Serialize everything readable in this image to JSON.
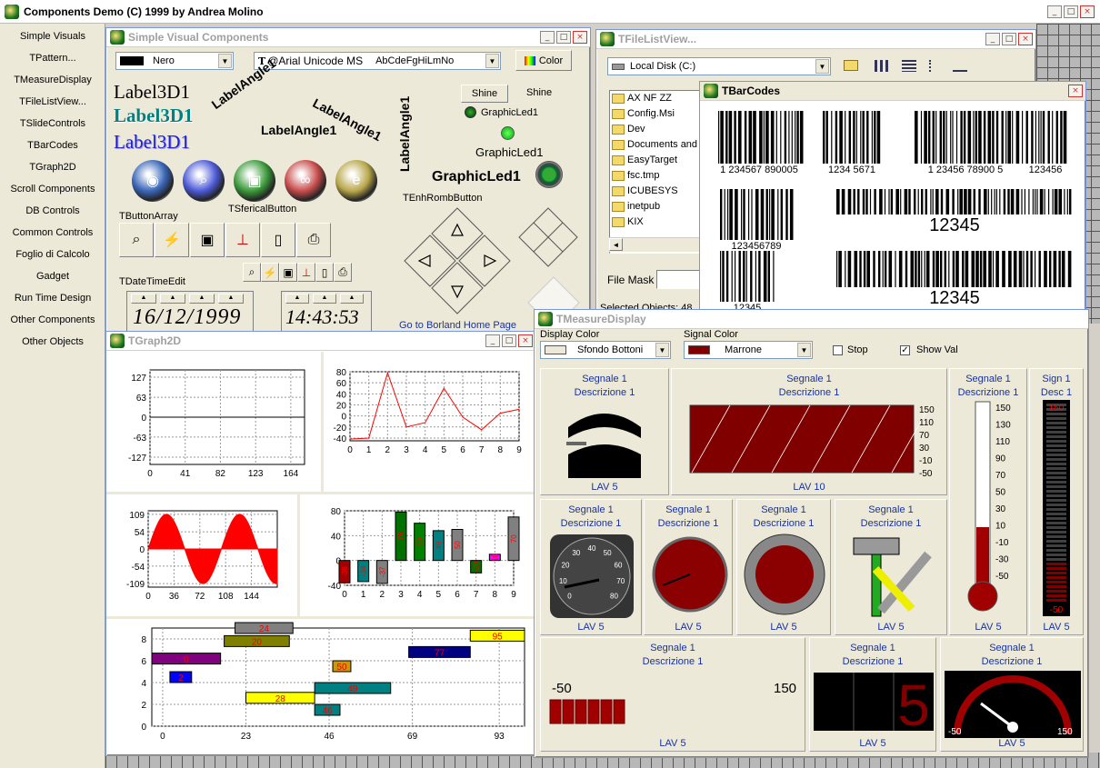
{
  "app": {
    "title": "Components Demo (C) 1999 by Andrea Molino"
  },
  "sidebar": {
    "items": [
      {
        "label": "Simple Visuals"
      },
      {
        "label": "TPattern..."
      },
      {
        "label": "TMeasureDisplay"
      },
      {
        "label": "TFileListView..."
      },
      {
        "label": "TSlideControls"
      },
      {
        "label": "TBarCodes"
      },
      {
        "label": "TGraph2D"
      },
      {
        "label": "Scroll Components"
      },
      {
        "label": "DB Controls"
      },
      {
        "label": "Common Controls"
      },
      {
        "label": "Foglio di Calcolo"
      },
      {
        "label": "Gadget"
      },
      {
        "label": "Run Time Design"
      },
      {
        "label": "Other Components"
      },
      {
        "label": "Other Objects"
      }
    ]
  },
  "simple": {
    "title": "Simple Visual Components",
    "color_combo": "Nero",
    "font_combo": "@Arial Unicode MS",
    "font_sample": "AbCdeFgHiLmNo",
    "color_btn": "Color",
    "label3d": "Label3D1",
    "label_angle": "LabelAngle1",
    "shine_btn": "Shine",
    "shine_lbl": "Shine",
    "graphicled": "GraphicLed1",
    "sferical": "TSfericalButton",
    "button_array": "TButtonArray",
    "enh_romb": "TEnhRombButton",
    "datetime_edit": "TDateTimeEdit",
    "date": "16/12/1999",
    "time": "14:43:53",
    "link": "Go to Borland Home Page"
  },
  "filelist": {
    "title": "TFileListView...",
    "drive": "Local Disk (C:)",
    "files": [
      "AX NF ZZ",
      "Config.Msi",
      "Dev",
      "Documents and S",
      "EasyTarget",
      "fsc.tmp",
      "ICUBESYS",
      "inetpub",
      "KIX"
    ],
    "file_mask": "File Mask",
    "selected": "Selected Objects: 48"
  },
  "barcodes": {
    "title": "TBarCodes",
    "codes": [
      {
        "text": "1 234567 890005"
      },
      {
        "text": "1234 5671"
      },
      {
        "text": "1 23456 78900 5"
      },
      {
        "text": "123456"
      },
      {
        "text": "123456789"
      },
      {
        "text": "12345"
      },
      {
        "text": "12345"
      },
      {
        "text": "12345"
      }
    ]
  },
  "graph2d": {
    "title": "TGraph2D"
  },
  "chart_data": [
    {
      "type": "line",
      "x": [
        0,
        41,
        82,
        123,
        164
      ],
      "xticks": [
        0,
        41,
        82,
        123,
        164
      ],
      "yticks": [
        127,
        63,
        0,
        -63,
        -127
      ],
      "ylim": [
        -150,
        150
      ],
      "series": [
        {
          "values": [
            0,
            0,
            0,
            0,
            0
          ]
        }
      ]
    },
    {
      "type": "line",
      "x": [
        0,
        1,
        2,
        3,
        4,
        5,
        6,
        7,
        8,
        9
      ],
      "xticks": [
        0,
        1,
        2,
        3,
        4,
        5,
        6,
        7,
        8,
        9
      ],
      "yticks": [
        80,
        60,
        40,
        20,
        0,
        -20,
        -40
      ],
      "ylim": [
        -45,
        80
      ],
      "series": [
        {
          "values": [
            -42,
            -40,
            78,
            -20,
            -12,
            50,
            -2,
            -25,
            5,
            12
          ]
        }
      ]
    },
    {
      "type": "area",
      "x": [
        0,
        180
      ],
      "xticks": [
        0,
        36,
        72,
        108,
        144
      ],
      "yticks": [
        109,
        54,
        0,
        -54,
        -109
      ],
      "ylim": [
        -120,
        120
      ],
      "series": [
        {
          "function": "sine",
          "amplitude": 109,
          "period": 102
        }
      ]
    },
    {
      "type": "bar",
      "x": [
        0,
        1,
        2,
        3,
        4,
        5,
        6,
        7,
        8,
        9
      ],
      "xticks": [
        0,
        1,
        2,
        3,
        4,
        5,
        6,
        7,
        8,
        9
      ],
      "yticks": [
        80,
        40,
        0,
        -40
      ],
      "ylim": [
        -40,
        80
      ],
      "values": [
        -36,
        -34,
        -37,
        78,
        60,
        48,
        50,
        -20,
        10,
        70
      ],
      "value_labels": [
        "-36",
        "-34",
        "-37",
        "78",
        "60",
        "48",
        "50",
        "-20",
        "10",
        "70"
      ]
    },
    {
      "type": "gantt",
      "xticks": [
        0,
        23,
        46,
        69,
        93
      ],
      "yticks": [
        8,
        6,
        4,
        2,
        0
      ],
      "xlim": [
        -3,
        100
      ],
      "ylim": [
        0,
        9
      ],
      "tasks": [
        {
          "label": "24",
          "start": 20,
          "end": 36,
          "y": 9,
          "color": "#808080"
        },
        {
          "label": "95",
          "start": 85,
          "end": 100,
          "y": 8.3,
          "color": "#ffff00"
        },
        {
          "label": "20",
          "start": 17,
          "end": 35,
          "y": 7.8,
          "color": "#808000"
        },
        {
          "label": "77",
          "start": 68,
          "end": 85,
          "y": 6.8,
          "color": "#000080"
        },
        {
          "label": "0",
          "start": -3,
          "end": 16,
          "y": 6.2,
          "color": "#800080"
        },
        {
          "label": "50",
          "start": 47,
          "end": 52,
          "y": 5.5,
          "color": "#cc9900"
        },
        {
          "label": "2",
          "start": 2,
          "end": 8,
          "y": 4.5,
          "color": "#0000ff"
        },
        {
          "label": "49",
          "start": 42,
          "end": 63,
          "y": 3.5,
          "color": "#008080"
        },
        {
          "label": "28",
          "start": 23,
          "end": 42,
          "y": 2.6,
          "color": "#ffff00"
        },
        {
          "label": "46",
          "start": 42,
          "end": 49,
          "y": 1.5,
          "color": "#008080"
        }
      ]
    }
  ],
  "measure": {
    "title": "TMeasureDisplay",
    "display_color_lbl": "Display Color",
    "display_color": "Sfondo Bottoni",
    "signal_color_lbl": "Signal Color",
    "signal_color": "Marrone",
    "stop": "Stop",
    "show_val": "Show Val",
    "signal": "Segnale 1",
    "desc": "Descrizione 1",
    "sign_short": "Sign 1",
    "desc_short": "Desc 1",
    "lav5": "LAV  5",
    "lav10": "LAV  10",
    "scale_main": [
      "150",
      "110",
      "70",
      "30",
      "-10",
      "-50"
    ],
    "thermo": [
      "150",
      "130",
      "110",
      "90",
      "70",
      "50",
      "30",
      "10",
      "-10",
      "-30",
      "-50"
    ],
    "bar_top": "150",
    "bar_bot": "-50",
    "gauge_ticks": [
      "0",
      "10",
      "20",
      "30",
      "40",
      "50",
      "60",
      "70",
      "80"
    ],
    "hbar_min": "-50",
    "hbar_max": "150",
    "seg_digit": "5",
    "arc_min": "-50",
    "arc_max": "150"
  }
}
